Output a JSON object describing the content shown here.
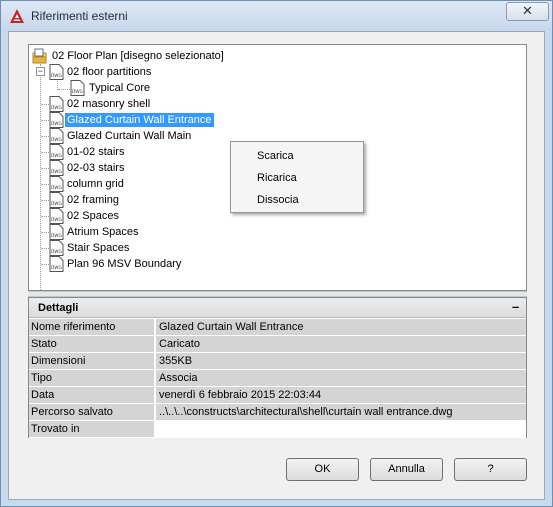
{
  "window": {
    "title": "Riferimenti esterni",
    "close_label": "✕"
  },
  "tree": {
    "root": {
      "label": "02 Floor Plan [disegno selezionato]"
    },
    "items": [
      {
        "label": "02 floor partitions",
        "expanded": true
      },
      {
        "label": "Typical Core"
      },
      {
        "label": "02 masonry shell"
      },
      {
        "label": "Glazed Curtain Wall Entrance",
        "selected": true
      },
      {
        "label": "Glazed Curtain Wall Main"
      },
      {
        "label": "01-02 stairs"
      },
      {
        "label": "02-03 stairs"
      },
      {
        "label": "column grid"
      },
      {
        "label": "02 framing"
      },
      {
        "label": "02 Spaces"
      },
      {
        "label": "Atrium Spaces"
      },
      {
        "label": "Stair Spaces"
      },
      {
        "label": "Plan 96 MSV Boundary"
      }
    ],
    "icon_text": "DWG"
  },
  "context_menu": {
    "items": [
      "Scarica",
      "Ricarica",
      "Dissocia"
    ]
  },
  "details": {
    "title": "Dettagli",
    "collapse_label": "–",
    "rows": [
      {
        "key": "Nome riferimento",
        "value": "Glazed Curtain Wall Entrance"
      },
      {
        "key": "Stato",
        "value": "Caricato"
      },
      {
        "key": "Dimensioni",
        "value": "355KB"
      },
      {
        "key": "Tipo",
        "value": "Associa"
      },
      {
        "key": "Data",
        "value": "venerdì 6 febbraio 2015  22:03:44"
      },
      {
        "key": "Percorso salvato",
        "value": "..\\..\\..\\constructs\\architectural\\shell\\curtain wall entrance.dwg"
      },
      {
        "key": "Trovato in",
        "value": ""
      }
    ]
  },
  "buttons": {
    "ok": "OK",
    "cancel": "Annulla",
    "help": "?"
  },
  "colors": {
    "selection": "#3399ff",
    "titlebar": "#c6d7eb",
    "app_icon": "#d02020"
  }
}
